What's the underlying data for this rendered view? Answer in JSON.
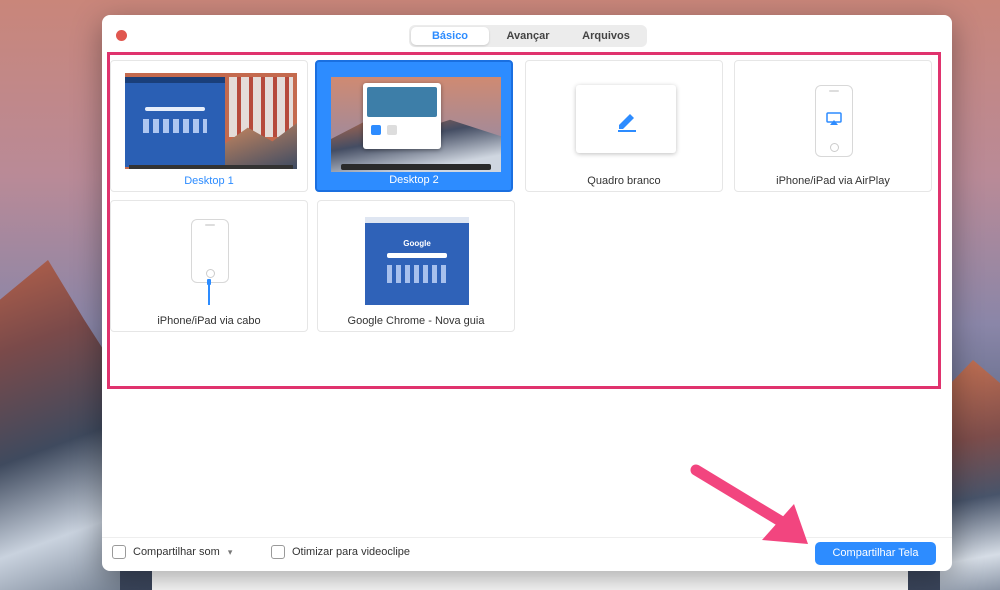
{
  "tabs": [
    {
      "label": "Básico",
      "active": true
    },
    {
      "label": "Avançar",
      "active": false
    },
    {
      "label": "Arquivos",
      "active": false
    }
  ],
  "tiles": [
    {
      "label": "Desktop 1",
      "selected": false
    },
    {
      "label": "Desktop 2",
      "selected": true
    },
    {
      "label": "Quadro branco",
      "selected": false
    },
    {
      "label": "iPhone/iPad via AirPlay",
      "selected": false
    },
    {
      "label": "iPhone/iPad via cabo",
      "selected": false
    },
    {
      "label": "Google Chrome - Nova guia",
      "selected": false
    }
  ],
  "chrome_thumb": {
    "logo_text": "Google"
  },
  "footer": {
    "share_sound_label": "Compartilhar som",
    "optimize_video_label": "Otimizar para videoclipe",
    "share_button_label": "Compartilhar Tela"
  },
  "colors": {
    "accent": "#2d8cff",
    "highlight_border": "#e0336e",
    "close_button": "#e0574f",
    "annotation_arrow": "#f2457f"
  },
  "icons": [
    "close-icon",
    "pencil-icon",
    "airplay-icon",
    "lightning-cable-icon",
    "chevron-down-icon",
    "annotation-arrow"
  ]
}
